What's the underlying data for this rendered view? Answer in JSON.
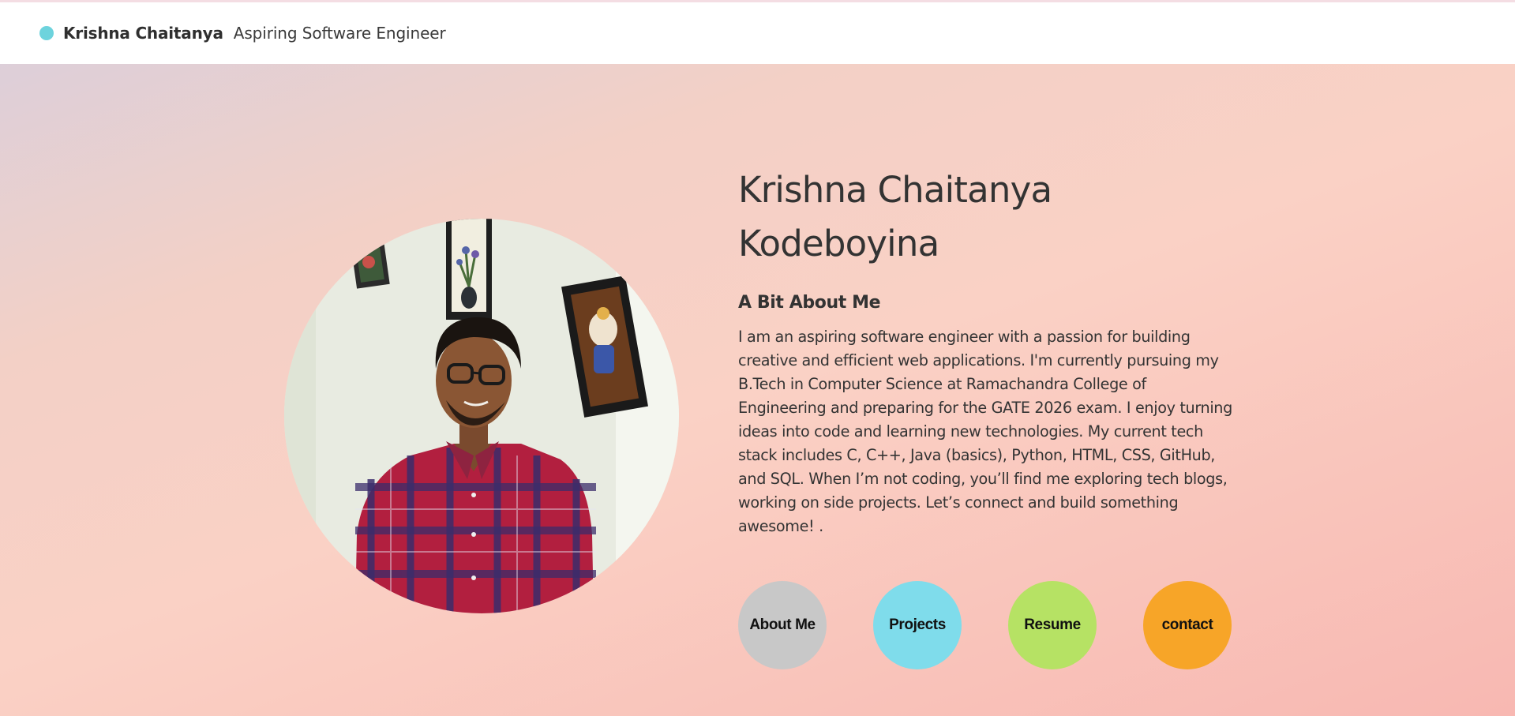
{
  "header": {
    "brand_name": "Krishna Chaitanya",
    "tagline": "Aspiring Software Engineer",
    "dot_color": "#6dd3dd"
  },
  "profile": {
    "name_line1": "Krishna Chaitanya",
    "name_line2": "Kodeboyina",
    "about_heading": "A Bit About Me",
    "about_text": "I am an aspiring software engineer with a passion for building creative and efficient web applications. I'm currently pursuing my B.Tech in Computer Science at Ramachandra College of Engineering and preparing for the GATE 2026 exam. I enjoy turning ideas into code and learning new technologies. My current tech stack includes C, C++, Java (basics), Python, HTML, CSS, GitHub, and SQL. When I’m not coding, you’ll find me exploring tech blogs, working on side projects. Let’s connect and build something awesome! ."
  },
  "nav": {
    "buttons": [
      {
        "label": "About Me",
        "color": "#c8c8c8"
      },
      {
        "label": "Projects",
        "color": "#7fdceb"
      },
      {
        "label": "Resume",
        "color": "#b6e264"
      },
      {
        "label": "contact",
        "color": "#f7a528"
      }
    ]
  }
}
